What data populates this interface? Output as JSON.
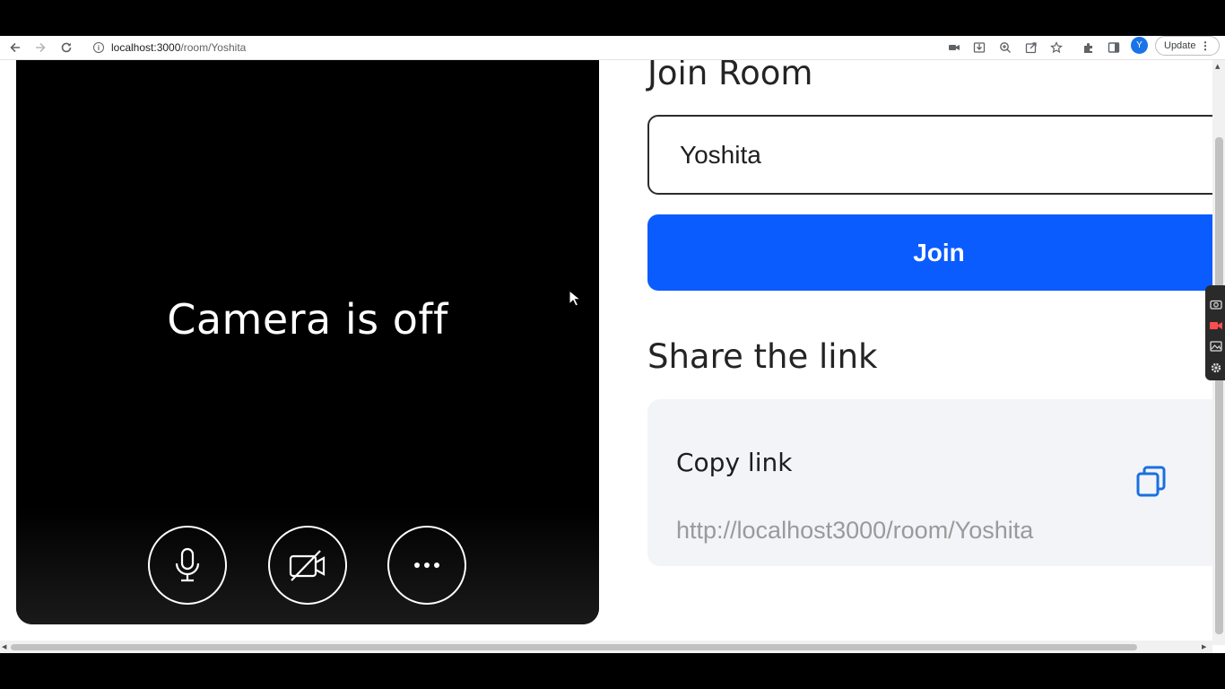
{
  "browser": {
    "url_host": "localhost:3000",
    "url_path": "/room/Yoshita",
    "avatar_letter": "Y",
    "update_label": "Update",
    "menu_glyph": "⋮",
    "icons": [
      "back-arrow-icon",
      "forward-arrow-icon",
      "reload-icon",
      "info-icon",
      "camera-icon",
      "install-icon",
      "zoom-icon",
      "share-icon",
      "star-icon",
      "extensions-icon",
      "side-panel-icon"
    ]
  },
  "video": {
    "status_text": "Camera is off",
    "controls": [
      {
        "name": "microphone",
        "icon": "microphone-icon"
      },
      {
        "name": "camera-toggle",
        "icon": "camera-off-icon"
      },
      {
        "name": "more-options",
        "icon": "more-dots-icon",
        "glyph": "•••"
      }
    ]
  },
  "join": {
    "heading": "Join Room",
    "room_value": "Yoshita",
    "button_label": "Join"
  },
  "share": {
    "heading": "Share the link",
    "copy_title": "Copy link",
    "link": "http://localhost3000/room/Yoshita",
    "copy_icon": "copy-icon"
  },
  "colors": {
    "primary": "#0a5cff",
    "video_bg": "#000000",
    "card_bg": "#f3f4f8",
    "link_text": "#9a9a9a"
  }
}
